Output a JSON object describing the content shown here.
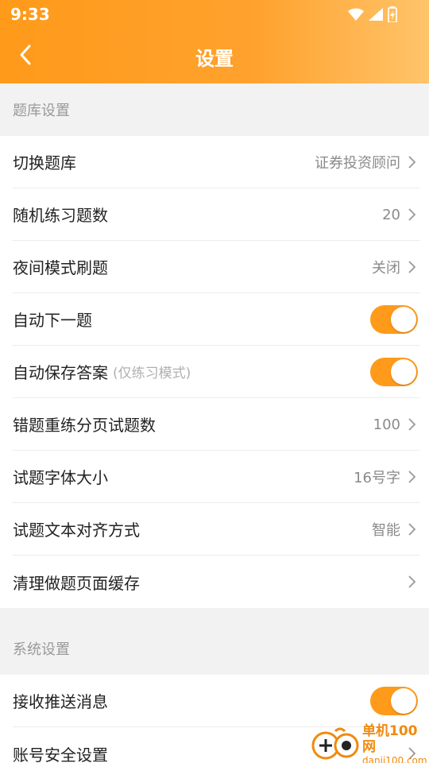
{
  "status": {
    "time": "9:33"
  },
  "header": {
    "title": "设置"
  },
  "sections": {
    "question_bank": {
      "title": "题库设置",
      "rows": [
        {
          "label": "切换题库",
          "value": "证券投资顾问"
        },
        {
          "label": "随机练习题数",
          "value": "20"
        },
        {
          "label": "夜间模式刷题",
          "value": "关闭"
        },
        {
          "label": "自动下一题",
          "toggle": true
        },
        {
          "label": "自动保存答案",
          "note": "(仅练习模式)",
          "toggle": true
        },
        {
          "label": "错题重练分页试题数",
          "value": "100"
        },
        {
          "label": "试题字体大小",
          "value": "16号字"
        },
        {
          "label": "试题文本对齐方式",
          "value": "智能"
        },
        {
          "label": "清理做题页面缓存",
          "value": ""
        }
      ]
    },
    "system": {
      "title": "系统设置",
      "rows": [
        {
          "label": "接收推送消息",
          "toggle": true
        },
        {
          "label": "账号安全设置"
        }
      ]
    }
  },
  "watermark": {
    "title": "单机100网",
    "sub": "danji100.com"
  },
  "colors": {
    "accent": "#ff9a1a",
    "background": "#f2f2f2"
  }
}
